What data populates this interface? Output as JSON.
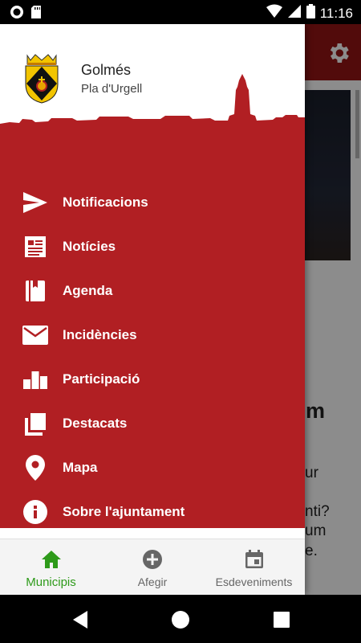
{
  "status_bar": {
    "time": "11:16",
    "icons": [
      "record-icon",
      "sd-card-icon",
      "wifi-icon",
      "signal-icon",
      "battery-icon"
    ]
  },
  "background": {
    "toolbar_icon": "gear-icon",
    "visible_text": [
      "m",
      "ur",
      "nti?",
      "um",
      "e."
    ]
  },
  "drawer": {
    "header": {
      "town_name": "Golmés",
      "region": "Pla d'Urgell",
      "crest_icon": "town-crest-icon"
    },
    "menu": [
      {
        "label": "Notificacions",
        "icon": "send-icon"
      },
      {
        "label": "Notícies",
        "icon": "newspaper-icon"
      },
      {
        "label": "Agenda",
        "icon": "agenda-book-icon"
      },
      {
        "label": "Incidències",
        "icon": "mail-icon"
      },
      {
        "label": "Participació",
        "icon": "bar-chart-icon"
      },
      {
        "label": "Destacats",
        "icon": "layers-icon"
      },
      {
        "label": "Mapa",
        "icon": "map-pin-icon"
      },
      {
        "label": "Sobre l'ajuntament",
        "icon": "info-icon"
      }
    ]
  },
  "bottom_nav": {
    "items": [
      {
        "label": "Municipis",
        "icon": "home-icon",
        "active": true
      },
      {
        "label": "Afegir",
        "icon": "add-circle-icon",
        "active": false
      },
      {
        "label": "Esdeveniments",
        "icon": "calendar-icon",
        "active": false
      }
    ]
  },
  "colors": {
    "brand_red": "#b11f23",
    "toolbar_red": "#961515",
    "active_green": "#2e9a1a",
    "inactive_gray": "#666666"
  }
}
